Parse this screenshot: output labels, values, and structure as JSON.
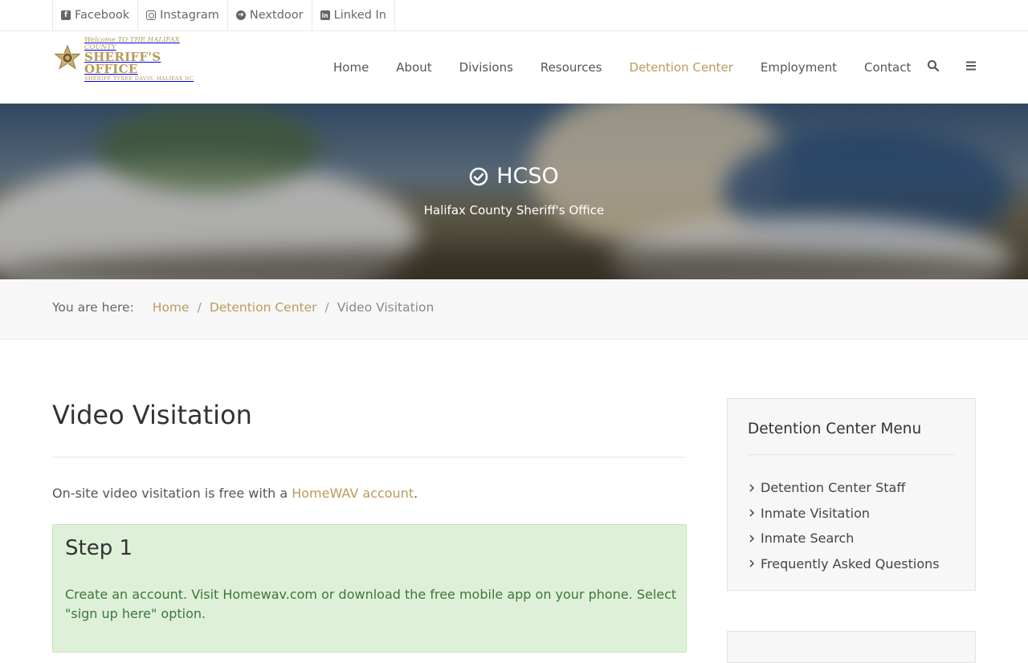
{
  "social": [
    {
      "label": "Facebook",
      "icon": "facebook-icon"
    },
    {
      "label": "Instagram",
      "icon": "instagram-icon"
    },
    {
      "label": "Nextdoor",
      "icon": "arrow-circle-right-icon"
    },
    {
      "label": "Linked In",
      "icon": "linkedin-icon"
    }
  ],
  "logo": {
    "line1": "Welcome TO THE HALIFAX COUNTY",
    "line2": "SHERIFF'S OFFICE",
    "line3": "SHERIFF TYREE DAVIS, HALIFAX NC"
  },
  "nav": [
    {
      "label": "Home"
    },
    {
      "label": "About"
    },
    {
      "label": "Divisions"
    },
    {
      "label": "Resources"
    },
    {
      "label": "Detention Center",
      "active": true
    },
    {
      "label": "Employment"
    },
    {
      "label": "Contact"
    }
  ],
  "header_icons": [
    "search-icon",
    "menu-icon"
  ],
  "hero": {
    "title": "HCSO",
    "subtitle": "Halifax County Sheriff's Office",
    "icon": "check-circle-icon"
  },
  "breadcrumb": {
    "prefix": "You are here:",
    "items": [
      "Home",
      "Detention Center"
    ],
    "current": "Video Visitation"
  },
  "main": {
    "title": "Video Visitation",
    "intro_before": "On-site video visitation is free with a ",
    "intro_link": "HomeWAV account",
    "intro_after": ".",
    "step": {
      "heading": "Step 1",
      "text": "Create an account. Visit Homewav.com or download the free mobile app on your phone. Select \"sign up here\" option."
    }
  },
  "sidebar": {
    "title": "Detention Center Menu",
    "items": [
      "Detention Center Staff",
      "Inmate Visitation",
      "Inmate Search",
      "Frequently Asked Questions"
    ]
  },
  "colors": {
    "accent": "#bc9a5c",
    "text": "#555555",
    "success_bg": "#dff0d8",
    "success_text": "#3c763d"
  }
}
